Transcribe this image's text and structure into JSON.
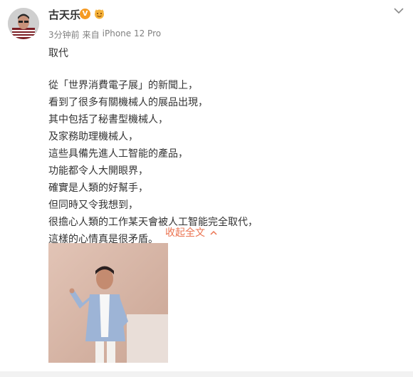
{
  "post": {
    "username": "古天乐",
    "badges": {
      "verified_icon": "verified-v-icon",
      "extra_icon": "fan-badge-icon"
    },
    "meta": {
      "time": "3分钟前",
      "source_prefix": "来自",
      "device": "iPhone 12 Pro"
    },
    "title": "取代",
    "lines": [
      "從「世界消費電子展」的新聞上，",
      "看到了很多有關機械人的展品出現，",
      "其中包括了秘書型機械人，",
      "及家務助理機械人，",
      "這些具備先進人工智能的產品，",
      "功能都令人大開眼界，",
      "確實是人類的好幫手，",
      "但同時又令我想到，",
      "很擔心人類的工作某天會被人工智能完全取代，",
      "這樣的心情真是很矛盾。"
    ],
    "collapse_label": "收起全文",
    "image_alt": "photo"
  },
  "colors": {
    "accent": "#eb7350",
    "verified": "#f59a23",
    "meta": "#808080"
  }
}
